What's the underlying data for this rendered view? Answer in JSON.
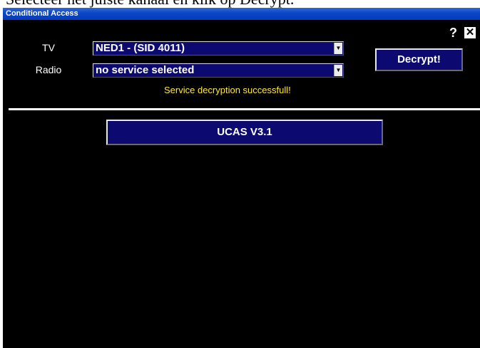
{
  "page": {
    "caption": "Selecteer het juiste kanaal en klik op Decrypt."
  },
  "window": {
    "title": "Conditional Access",
    "help_glyph": "?",
    "close_glyph": "✕"
  },
  "form": {
    "tv_label": "TV",
    "tv_value": "NED1 - (SID 4011)",
    "radio_label": "Radio",
    "radio_value": "no service selected",
    "decrypt_button": "Decrypt!",
    "status": "Service decryption successfull!",
    "dropdown_arrow": "▼"
  },
  "module": {
    "button_label": "UCAS V3.1"
  },
  "colors": {
    "background": "#000000",
    "field": "#0c0a70",
    "status_text": "#ffe83a",
    "titlebar": "#0a45c8"
  }
}
